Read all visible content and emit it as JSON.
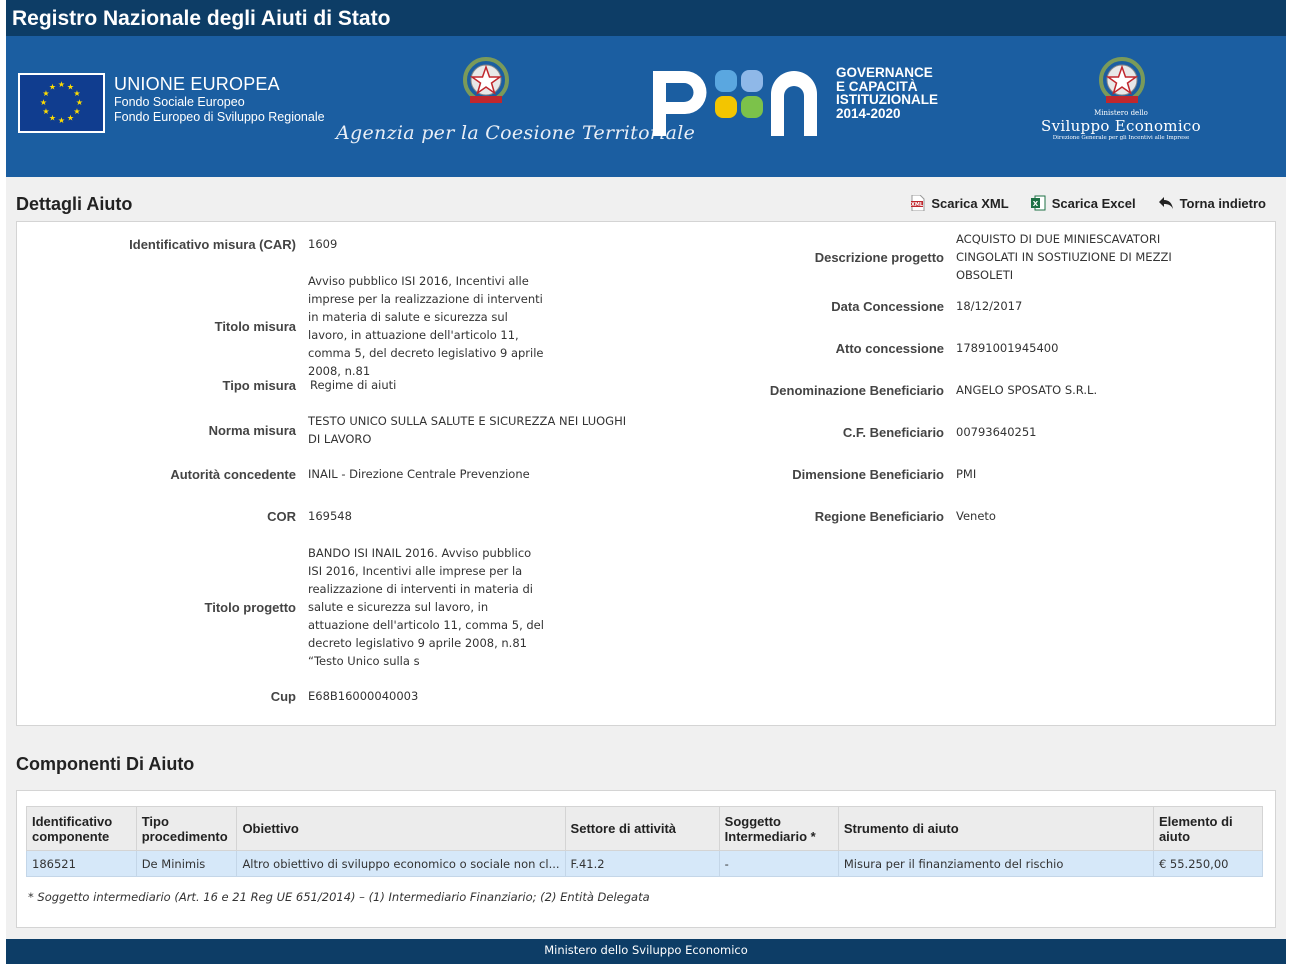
{
  "app_title": "Registro Nazionale degli Aiuti di Stato",
  "banner": {
    "eu_title": "UNIONE EUROPEA",
    "eu_line1": "Fondo Sociale Europeo",
    "eu_line2": "Fondo Europeo di Sviluppo Regionale",
    "agency": "Agenzia per la Coesione Territoriale",
    "pon_line1": "GOVERNANCE",
    "pon_line2": "E CAPACITÀ",
    "pon_line3": "ISTITUZIONALE",
    "pon_line4": "2014-2020",
    "mise_small": "Ministero dello",
    "mise_big": "Sviluppo Economico",
    "mise_tiny": "Direzione Generale per gli Incentivi alle Imprese"
  },
  "details": {
    "title": "Dettagli Aiuto",
    "actions": {
      "xml": "Scarica XML",
      "excel": "Scarica Excel",
      "back": "Torna indietro"
    },
    "left": [
      {
        "label": "Identificativo misura (CAR)",
        "value": "1609"
      },
      {
        "label": "Titolo misura",
        "value": "Avviso pubblico ISI 2016, Incentivi alle imprese per la realizzazione di interventi in materia di salute e sicurezza sul lavoro, in attuazione dell'articolo 11, comma 5, del decreto legislativo 9 aprile 2008, n.81"
      },
      {
        "label": "Tipo misura",
        "value": "Regime di aiuti"
      },
      {
        "label": "Norma misura",
        "value": "TESTO UNICO SULLA SALUTE E SICUREZZA NEI LUOGHI DI LAVORO"
      },
      {
        "label": "Autorità concedente",
        "value": "INAIL - Direzione Centrale Prevenzione"
      },
      {
        "label": "COR",
        "value": "169548"
      },
      {
        "label": "Titolo progetto",
        "value": "BANDO ISI INAIL 2016. Avviso pubblico ISI 2016, Incentivi alle imprese per la realizzazione di interventi in materia di salute e sicurezza sul lavoro, in attuazione dell'articolo 11, comma 5, del decreto legislativo 9 aprile 2008, n.81 “Testo Unico sulla s"
      },
      {
        "label": "Cup",
        "value": "E68B16000040003"
      }
    ],
    "right": [
      {
        "label": "Descrizione progetto",
        "value": "ACQUISTO DI DUE MINIESCAVATORI CINGOLATI IN SOSTIUZIONE DI MEZZI OBSOLETI"
      },
      {
        "label": "Data Concessione",
        "value": "18/12/2017"
      },
      {
        "label": "Atto concessione",
        "value": "17891001945400"
      },
      {
        "label": "Denominazione Beneficiario",
        "value": "ANGELO SPOSATO S.R.L."
      },
      {
        "label": "C.F. Beneficiario",
        "value": "00793640251"
      },
      {
        "label": "Dimensione Beneficiario",
        "value": "PMI"
      },
      {
        "label": "Regione Beneficiario",
        "value": "Veneto"
      }
    ]
  },
  "components": {
    "title": "Componenti Di Aiuto",
    "headers": [
      "Identificativo componente",
      "Tipo procedimento",
      "Obiettivo",
      "Settore di attività",
      "Soggetto Intermediario *",
      "Strumento di aiuto",
      "Elemento di aiuto"
    ],
    "rows": [
      [
        "186521",
        "De Minimis",
        "Altro obiettivo di sviluppo economico o sociale non cl...",
        "F.41.2",
        "-",
        "Misura per il finanziamento del rischio",
        "€ 55.250,00"
      ]
    ],
    "note": "* Soggetto intermediario (Art. 16 e 21 Reg UE 651/2014) – (1) Intermediario Finanziario; (2) Entità Delegata"
  },
  "footer": "Ministero dello Sviluppo Economico",
  "colors": {
    "header_bg": "#0d3d66",
    "banner_bg": "#1b5ea1",
    "row_highlight": "#d6e8f9",
    "page_bg": "#f0f0f0"
  }
}
